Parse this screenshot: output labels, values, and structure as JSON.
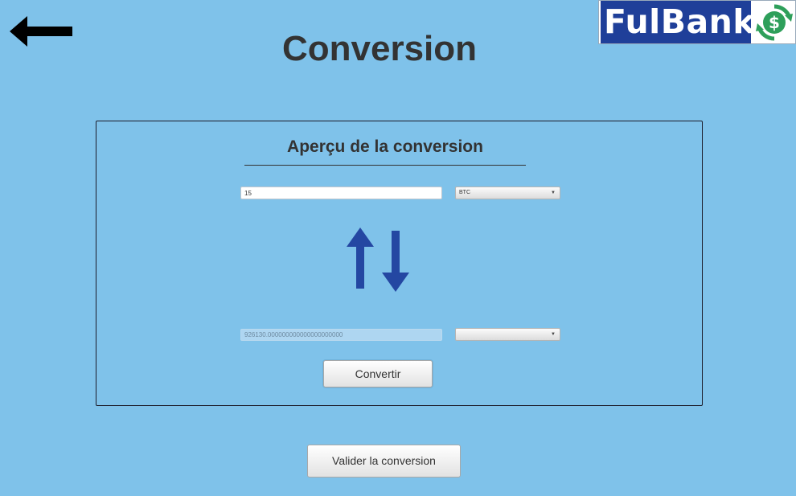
{
  "header": {
    "title": "Conversion",
    "back_icon": "arrow-left-icon",
    "logo": {
      "text": "FulBank",
      "icon": "dollar-cycle-icon",
      "brand_color": "#1f3f99"
    }
  },
  "panel": {
    "title": "Aperçu de la conversion",
    "amount_input": {
      "value": "15"
    },
    "from_currency": {
      "selected": "BTC"
    },
    "swap_icon": "swap-vertical-arrows-icon",
    "result_input": {
      "value": "926130.000000000000000000000"
    },
    "to_currency": {
      "selected": ""
    },
    "convert_label": "Convertir"
  },
  "footer": {
    "validate_label": "Valider la conversion"
  },
  "colors": {
    "background": "#7fc2ea",
    "arrows": "#2447a2",
    "title_text": "#333333"
  }
}
